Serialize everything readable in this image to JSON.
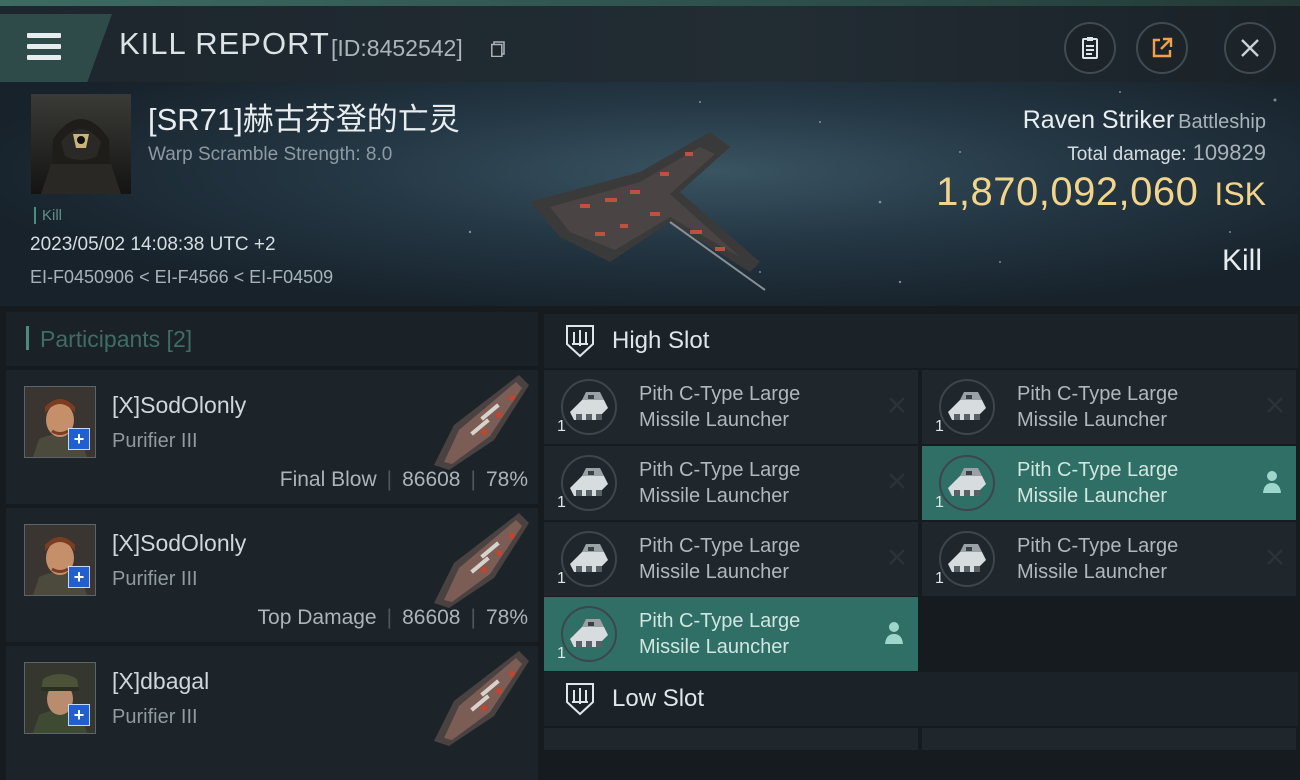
{
  "header": {
    "title": "KILL REPORT",
    "report_id": "[ID:8452542]"
  },
  "victim": {
    "name": "[SR71]赫古芬登的亡灵",
    "warp_scramble": "Warp Scramble Strength: 8.0",
    "kill_tag": "Kill",
    "timestamp": "2023/05/02 14:08:38 UTC +2",
    "location": "EI-F0450906 < EI-F4566 < EI-F04509",
    "ship_name": "Raven Striker",
    "ship_class": "Battleship",
    "total_damage_label": "Total damage:",
    "total_damage": "109829",
    "isk_value": "1,870,092,060",
    "isk_unit": "ISK",
    "kill_type": "Kill"
  },
  "participants": {
    "title": "Participants [2]",
    "items": [
      {
        "name": "[X]SodOlonly",
        "ship": "Purifier III",
        "tag": "Final Blow",
        "damage": "86608",
        "percent": "78%"
      },
      {
        "name": "[X]SodOlonly",
        "ship": "Purifier III",
        "tag": "Top Damage",
        "damage": "86608",
        "percent": "78%"
      },
      {
        "name": "[X]dbagal",
        "ship": "Purifier III"
      }
    ]
  },
  "slots": {
    "high_title": "High Slot",
    "low_title": "Low Slot",
    "high": [
      {
        "line1": "Pith C-Type Large",
        "line2": "Missile Launcher",
        "qty": "1",
        "state": "destroyed"
      },
      {
        "line1": "Pith C-Type Large",
        "line2": "Missile Launcher",
        "qty": "1",
        "state": "destroyed"
      },
      {
        "line1": "Pith C-Type Large",
        "line2": "Missile Launcher",
        "qty": "1",
        "state": "destroyed"
      },
      {
        "line1": "Pith C-Type Large",
        "line2": "Missile Launcher",
        "qty": "1",
        "state": "dropped"
      },
      {
        "line1": "Pith C-Type Large",
        "line2": "Missile Launcher",
        "qty": "1",
        "state": "destroyed"
      },
      {
        "line1": "Pith C-Type Large",
        "line2": "Missile Launcher",
        "qty": "1",
        "state": "destroyed"
      },
      {
        "line1": "Pith C-Type Large",
        "line2": "Missile Launcher",
        "qty": "1",
        "state": "dropped"
      }
    ]
  },
  "colors": {
    "accent": "#4d8a7f",
    "dropped": "#2f6f66",
    "isk": "#f2d48a"
  }
}
